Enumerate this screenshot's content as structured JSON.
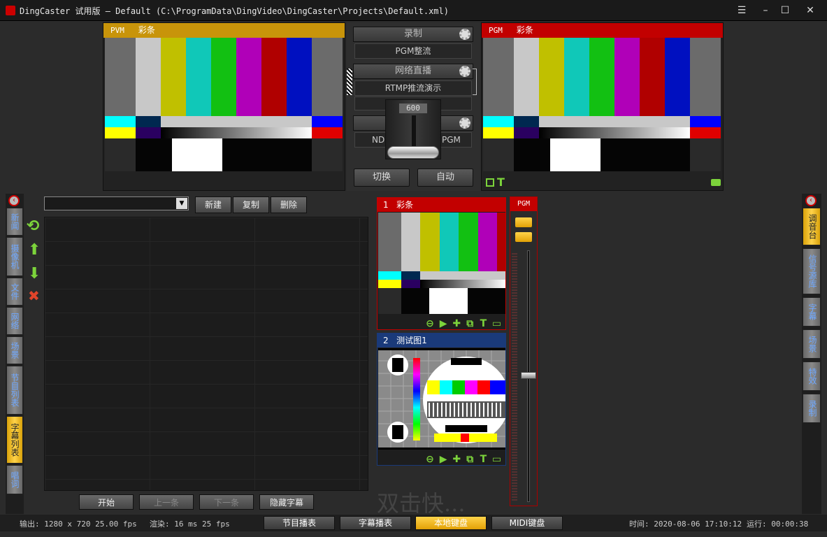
{
  "window": {
    "title": "DingCaster 试用版 — Default (C:\\ProgramData\\DingVideo\\DingCaster\\Projects\\Default.xml)",
    "buttons": [
      "menu-icon",
      "minimize-icon",
      "maximize-icon",
      "close-icon"
    ]
  },
  "pvm": {
    "tag": "PVM",
    "label": "彩条",
    "color": "#c8940a"
  },
  "pgm": {
    "tag": "PGM",
    "label": "彩条",
    "color": "#c20000"
  },
  "center": {
    "record": {
      "title": "录制",
      "value": "PGM整流"
    },
    "stream": {
      "title": "网络直播",
      "value": "RTMP推流演示",
      "value2": ""
    },
    "ndi": {
      "value_left": "NDI-",
      "value_right": "PGM"
    },
    "tbar_value": "600",
    "switch_button": "切换",
    "auto_button": "自动"
  },
  "left_tabs": [
    "新闻",
    "摄像机",
    "文件",
    "网络",
    "场景",
    "节目列表",
    "字幕列表",
    "唱词"
  ],
  "left_active_tab": "字幕列表",
  "toolbar": {
    "select_value": "",
    "new": "新建",
    "copy": "复制",
    "delete": "删除"
  },
  "subtitle_controls": {
    "start": "开始",
    "prev": "上一条",
    "next": "下一条",
    "hide": "隐藏字幕"
  },
  "sources": [
    {
      "index": "1",
      "name": "彩条",
      "color": "#c20000"
    },
    {
      "index": "2",
      "name": "测试图1",
      "color": "#1a3a7a"
    }
  ],
  "audio": {
    "label": "PGM"
  },
  "watermark": "双击快...",
  "right_tabs": [
    "调音台",
    "信号源库",
    "字幕",
    "场景",
    "特效",
    "录制"
  ],
  "right_active_tab": "调音台",
  "status": {
    "output": "输出: 1280 x 720 25.00 fps",
    "render": "渲染: 16 ms 25 fps",
    "time": "时间: 2020-08-06 17:10:12",
    "run": "运行: 00:00:38"
  },
  "bottom_buttons": [
    {
      "label": "节目播表",
      "active": false
    },
    {
      "label": "字幕播表",
      "active": false
    },
    {
      "label": "本地键盘",
      "active": true
    },
    {
      "label": "MIDI键盘",
      "active": false
    }
  ]
}
